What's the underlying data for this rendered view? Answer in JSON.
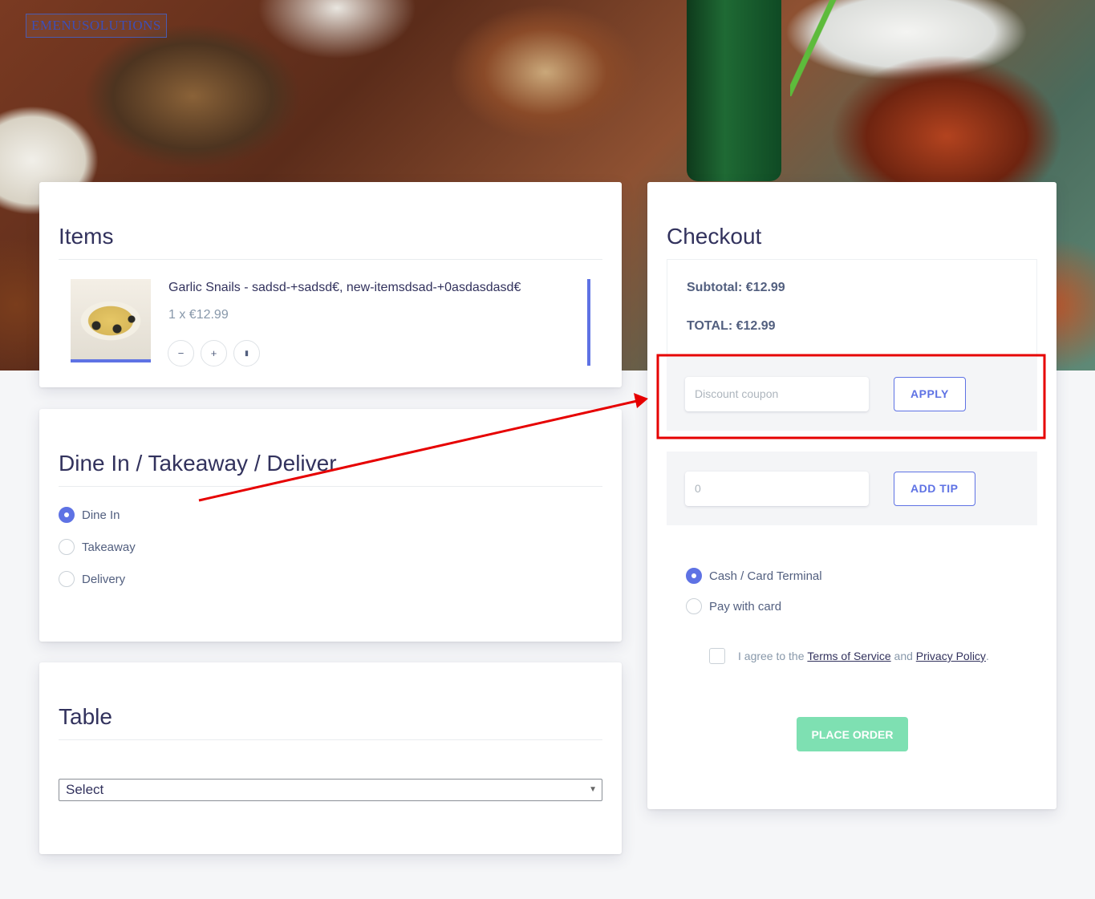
{
  "brand": {
    "logo_text": "EMENUSOLUTIONS"
  },
  "items_section": {
    "title": "Items",
    "items": [
      {
        "name": "Garlic Snails - sadsd-+sadsd€, new-itemsdsad-+0asdasdasd€",
        "qty_price": "1 x €12.99"
      }
    ],
    "buttons": {
      "minus": "−",
      "plus": "+",
      "delete": "🗑"
    }
  },
  "mode_section": {
    "title": "Dine In / Takeaway / Deliver",
    "options": [
      {
        "label": "Dine In",
        "selected": true
      },
      {
        "label": "Takeaway",
        "selected": false
      },
      {
        "label": "Delivery",
        "selected": false
      }
    ]
  },
  "table_section": {
    "title": "Table",
    "select_value": "Select"
  },
  "checkout": {
    "title": "Checkout",
    "subtotal": "Subtotal: €12.99",
    "total": "TOTAL: €12.99",
    "coupon_placeholder": "Discount coupon",
    "apply_label": "APPLY",
    "tip_value": "0",
    "add_tip_label": "ADD TIP",
    "payment_options": [
      {
        "label": "Cash / Card Terminal",
        "selected": true
      },
      {
        "label": "Pay with card",
        "selected": false
      }
    ],
    "agree_prefix": "I agree to the",
    "terms_label": "Terms of Service",
    "agree_and": "and",
    "privacy_label": "Privacy Policy",
    "agree_suffix": ".",
    "place_order_label": "PLACE ORDER"
  },
  "colors": {
    "accent": "#5e72e4",
    "success_light": "#7ee0b2",
    "annotation": "#e60000"
  }
}
